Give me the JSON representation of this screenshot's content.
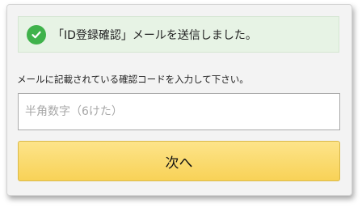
{
  "banner": {
    "icon": "check-circle-icon",
    "icon_color": "#3fb24b",
    "message": "「ID登録確認」メールを送信しました。"
  },
  "form": {
    "instruction": "メールに記載されている確認コードを入力して下さい。",
    "code_input": {
      "value": "",
      "placeholder": "半角数字（6けた）"
    },
    "next_button_label": "次へ",
    "button_color": "#f8d257"
  }
}
